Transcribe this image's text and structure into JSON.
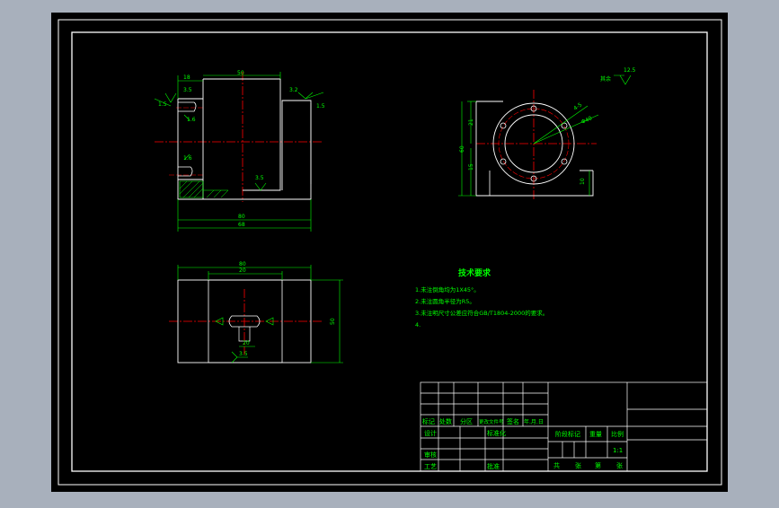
{
  "colors": {
    "desktop": "#a8b0bc",
    "paper": "#000000",
    "frame": "#ffffff",
    "outline": "#ffffff",
    "dimension": "#00ff00",
    "centerline": "#ff0000",
    "hatch": "#00ff00",
    "hidden": "#ffff00"
  },
  "views": {
    "front": {
      "dims": {
        "top_small": "18",
        "top_wide": "50",
        "slot_top": "3.5",
        "left_slot": "3.5",
        "left_slot2": "1.6",
        "left_side": "1.5",
        "left_lower": "1.6",
        "right_top": "3.2",
        "right_side": "1.5",
        "inner_bottom": "3.5",
        "overall_inner": "80",
        "overall": "68"
      }
    },
    "side": {
      "dims": {
        "height_total": "60",
        "upper": "21",
        "lower": "15",
        "hole_dim": "4-5",
        "circle_dim": "Φ40",
        "base": "10"
      },
      "surface_mark": {
        "label": "其余",
        "value": "12.5"
      }
    },
    "top": {
      "dims": {
        "width_outer": "80",
        "width_inner": "20",
        "height": "50",
        "slot_width": "20",
        "roughness": "3.5"
      }
    }
  },
  "requirements": {
    "title": "技术要求",
    "items": [
      "1.未注倒角均为1X45°。",
      "2.未注圆角半径为R5。",
      "3.未注明尺寸公差应符合GB/T1804-2000的要求。",
      "4."
    ]
  },
  "title_block": {
    "header_cols": [
      "标记",
      "处数",
      "分区",
      "更改文件号",
      "签名",
      "年.月.日"
    ],
    "rows": [
      {
        "label": "设计",
        "mid": "标准化"
      },
      {
        "label": "审核",
        "mid": ""
      },
      {
        "label": "工艺",
        "mid": "批准"
      }
    ],
    "stage_mark": "阶段标记",
    "weight": "重量",
    "ratio_label": "比例",
    "ratio_value": "1:1",
    "sheets": [
      "共",
      "张",
      "第",
      "张"
    ]
  }
}
